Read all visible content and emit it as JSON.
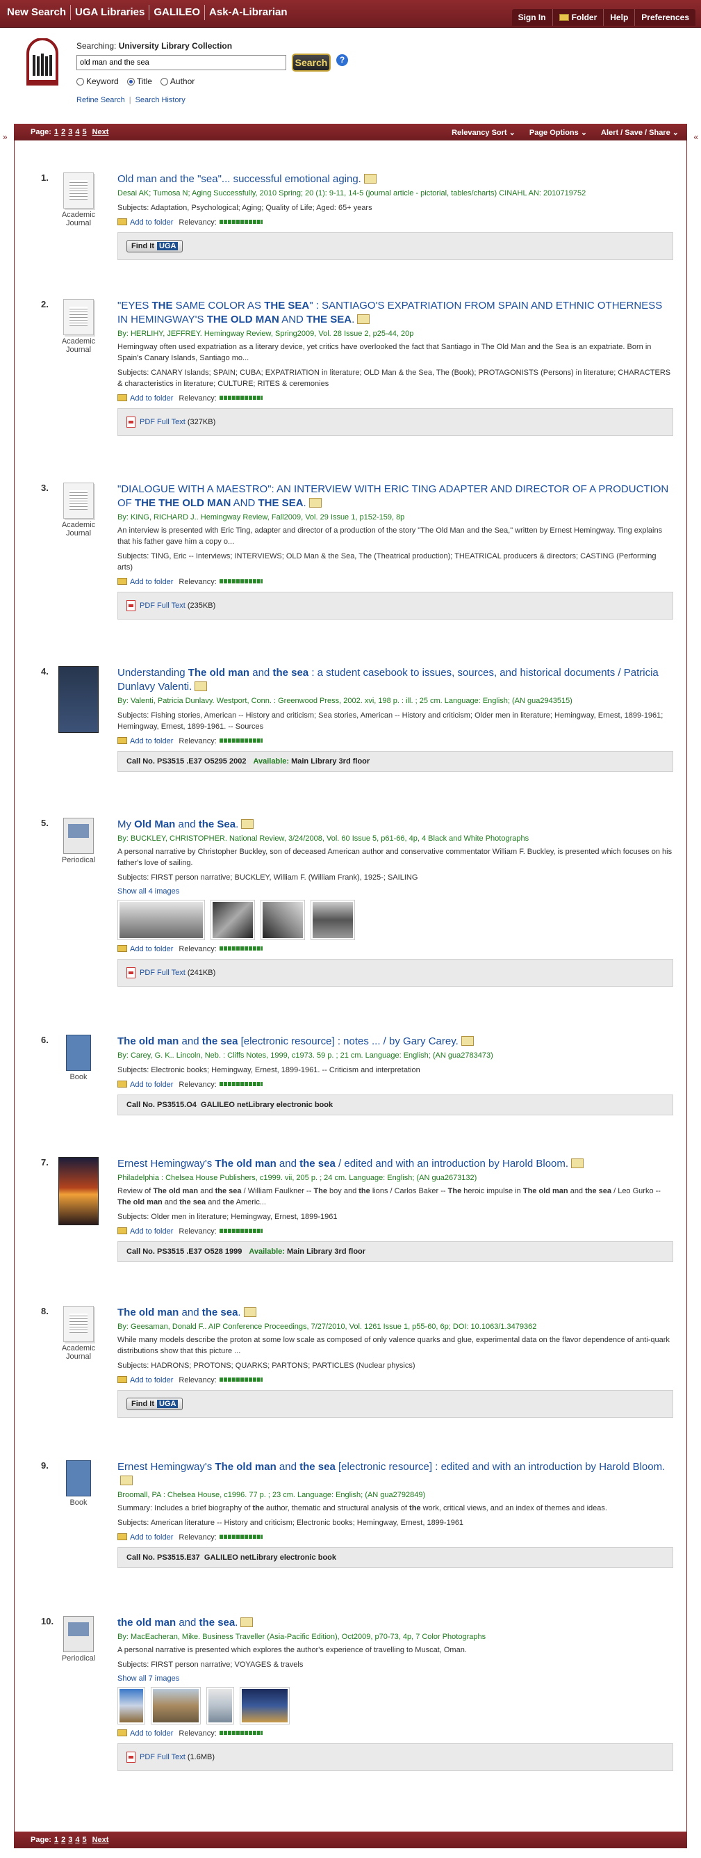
{
  "topnav": [
    "New Search",
    "UGA Libraries",
    "GALILEO",
    "Ask-A-Librarian"
  ],
  "rightnav": [
    "Sign In",
    "Folder",
    "Help",
    "Preferences"
  ],
  "search": {
    "searching_label": "Searching:",
    "collection": "University Library Collection",
    "query": "old man and the sea",
    "button": "Search",
    "help": "?",
    "options": [
      "Keyword",
      "Title",
      "Author"
    ],
    "selected": "Title",
    "refine": "Refine Search",
    "history": "Search History"
  },
  "toolbar": {
    "page_label": "Page:",
    "pages": [
      "1",
      "2",
      "3",
      "4",
      "5"
    ],
    "next": "Next",
    "menus": [
      "Relevancy Sort",
      "Page Options",
      "Alert / Save / Share"
    ]
  },
  "labels": {
    "add_to_folder": "Add to folder",
    "relevancy": "Relevancy:",
    "pdf_full_text": "PDF Full Text",
    "find_it": "Find It",
    "uga": "UGA",
    "call_no": "Call No.",
    "available": "Available:"
  },
  "results": [
    {
      "num": "1.",
      "type": "Academic Journal",
      "source": "Desai AK; Tumosa N; Aging Successfully, 2010 Spring; 20 (1): 9-11, 14-5 (journal article - pictorial, tables/charts) CINAHL AN: 2010719752",
      "subjects": "Subjects: Adaptation, Psychological; Aging; Quality of Life; Aged: 65+ years"
    },
    {
      "num": "2.",
      "type": "Academic Journal",
      "source": "By: HERLIHY, JEFFREY. Hemingway Review, Spring2009, Vol. 28 Issue 2, p25-44, 20p",
      "abstract": "Hemingway often used expatriation as a literary device, yet critics have overlooked the fact that Santiago in The Old Man and the Sea is an expatriate. Born in Spain's Canary Islands, Santiago mo...",
      "subjects": "Subjects: CANARY Islands; SPAIN; CUBA; EXPATRIATION in literature; OLD Man & the Sea, The (Book); PROTAGONISTS (Persons) in literature; CHARACTERS & characteristics in literature; CULTURE; RITES & ceremonies",
      "pdf": "(327KB)"
    },
    {
      "num": "3.",
      "type": "Academic Journal",
      "source": "By: KING, RICHARD J.. Hemingway Review, Fall2009, Vol. 29 Issue 1, p152-159, 8p",
      "abstract": "An interview is presented with Eric Ting, adapter and director of a production of the story \"The Old Man and the Sea,\" written by Ernest Hemingway. Ting explains that his father gave him a copy o...",
      "subjects": "Subjects: TING, Eric -- Interviews; INTERVIEWS; OLD Man & the Sea, The (Theatrical production); THEATRICAL producers & directors; CASTING (Performing arts)",
      "pdf": "(235KB)"
    },
    {
      "num": "4.",
      "source": "By: Valenti, Patricia Dunlavy. Westport, Conn. : Greenwood Press, 2002. xvi, 198 p. : ill. ; 25 cm. Language: English; (AN gua2943515)",
      "subjects": "Subjects: Fishing stories, American -- History and criticism; Sea stories, American -- History and criticism; Older men in literature; Hemingway, Ernest, 1899-1961; Hemingway, Ernest, 1899-1961. -- Sources",
      "call": "PS3515 .E37 O5295 2002",
      "location": "Main Library 3rd floor"
    },
    {
      "num": "5.",
      "type": "Periodical",
      "source": "By: BUCKLEY, CHRISTOPHER. National Review, 3/24/2008, Vol. 60 Issue 5, p61-66, 4p, 4 Black and White Photographs",
      "abstract": "A personal narrative by Christopher Buckley, son of deceased American author and conservative commentator William F. Buckley, is presented which focuses on his father's love of sailing.",
      "subjects": "Subjects: FIRST person narrative; BUCKLEY, William F. (William Frank), 1925-; SAILING",
      "showall": "Show all 4 images",
      "pdf": "(241KB)"
    },
    {
      "num": "6.",
      "type": "Book",
      "source": "By: Carey, G. K.. Lincoln, Neb. : Cliffs Notes, 1999, c1973. 59 p. ; 21 cm. Language: English; (AN gua2783473)",
      "subjects": "Subjects: Electronic books; Hemingway, Ernest, 1899-1961. -- Criticism and interpretation",
      "call": "PS3515.O4",
      "location": "GALILEO netLibrary electronic book"
    },
    {
      "num": "7.",
      "source": "Philadelphia : Chelsea House Publishers, c1999. vii, 205 p. ; 24 cm. Language: English; (AN gua2673132)",
      "subjects": "Subjects: Older men in literature; Hemingway, Ernest, 1899-1961",
      "call": "PS3515 .E37 O528 1999",
      "location": "Main Library 3rd floor"
    },
    {
      "num": "8.",
      "type": "Academic Journal",
      "source": "By: Geesaman, Donald F.. AIP Conference Proceedings, 7/27/2010, Vol. 1261 Issue 1, p55-60, 6p; DOI: 10.1063/1.3479362",
      "abstract": "While many models describe the proton at some low scale as composed of only valence quarks and glue, experimental data on the flavor dependence of anti-quark distributions show that this picture ...",
      "subjects": "Subjects: HADRONS; PROTONS; QUARKS; PARTONS; PARTICLES (Nuclear physics)"
    },
    {
      "num": "9.",
      "type": "Book",
      "source": "Broomall, PA : Chelsea House, c1996. 77 p. ; 23 cm. Language: English; (AN gua2792849)",
      "subjects": "Subjects: American literature -- History and criticism; Electronic books; Hemingway, Ernest, 1899-1961",
      "call": "PS3515.E37",
      "location": "GALILEO netLibrary electronic book"
    },
    {
      "num": "10.",
      "type": "Periodical",
      "source": "By: MacEacheran, Mike. Business Traveller (Asia-Pacific Edition), Oct2009, p70-73, 4p, 7 Color Photographs",
      "abstract": "A personal narrative is presented which explores the author's experience of travelling to Muscat, Oman.",
      "subjects": "Subjects: FIRST person narrative; VOYAGES & travels",
      "showall": "Show all 7 images",
      "pdf": "(1.6MB)"
    }
  ]
}
